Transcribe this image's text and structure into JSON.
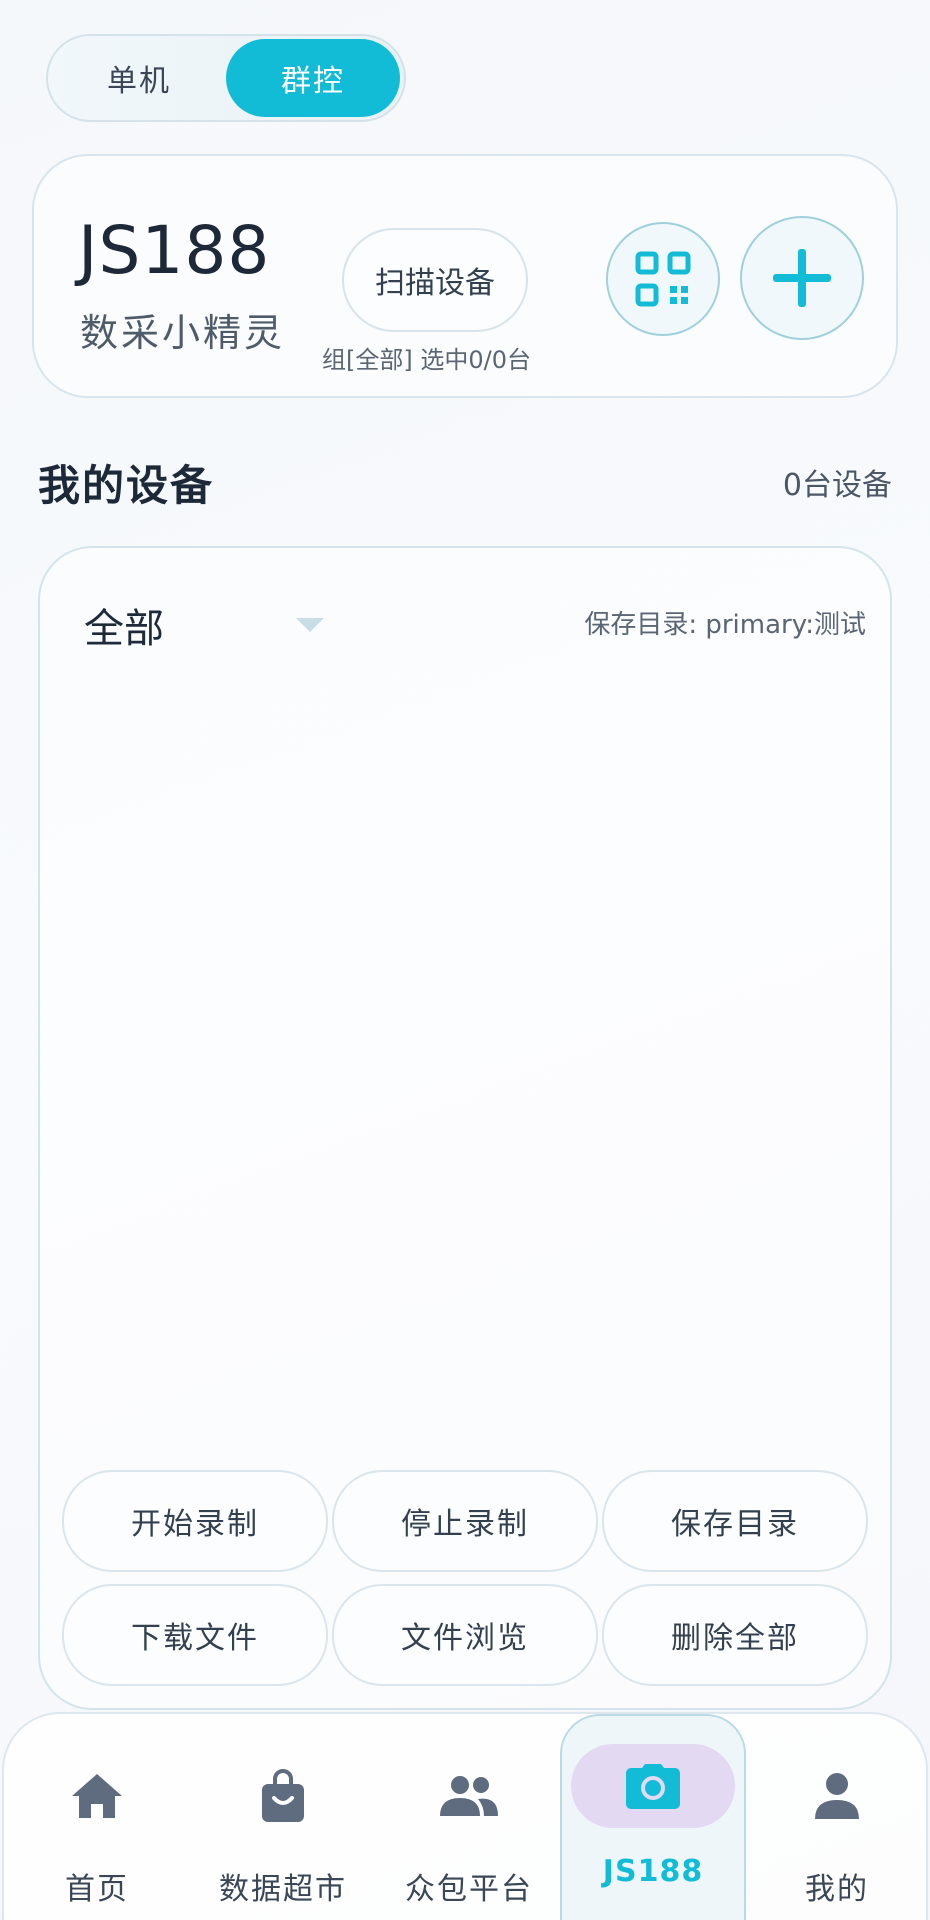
{
  "mode_toggle": {
    "single_label": "单机",
    "group_label": "群控",
    "selected": "群控"
  },
  "brand": {
    "title": "JS188",
    "subtitle": "数采小精灵"
  },
  "scan_button_label": "扫描设备",
  "group_info": "组[全部] 选中0/0台",
  "section": {
    "title": "我的设备",
    "count": "0台设备"
  },
  "device_panel": {
    "group_value": "全部",
    "save_dir": "保存目录: primary:测试",
    "actions": [
      "开始录制",
      "停止录制",
      "保存目录",
      "下载文件",
      "文件浏览",
      "删除全部"
    ]
  },
  "nav": [
    {
      "label": "首页",
      "icon": "home-icon"
    },
    {
      "label": "数据超市",
      "icon": "shopping-bag-icon"
    },
    {
      "label": "众包平台",
      "icon": "people-icon"
    },
    {
      "label": "JS188",
      "icon": "camera-icon",
      "active": true
    },
    {
      "label": "我的",
      "icon": "person-icon"
    }
  ],
  "colors": {
    "accent": "#13bcd6",
    "active_icon_bg": "#e3d9f2",
    "icon_gray": "#5f6b7e"
  }
}
